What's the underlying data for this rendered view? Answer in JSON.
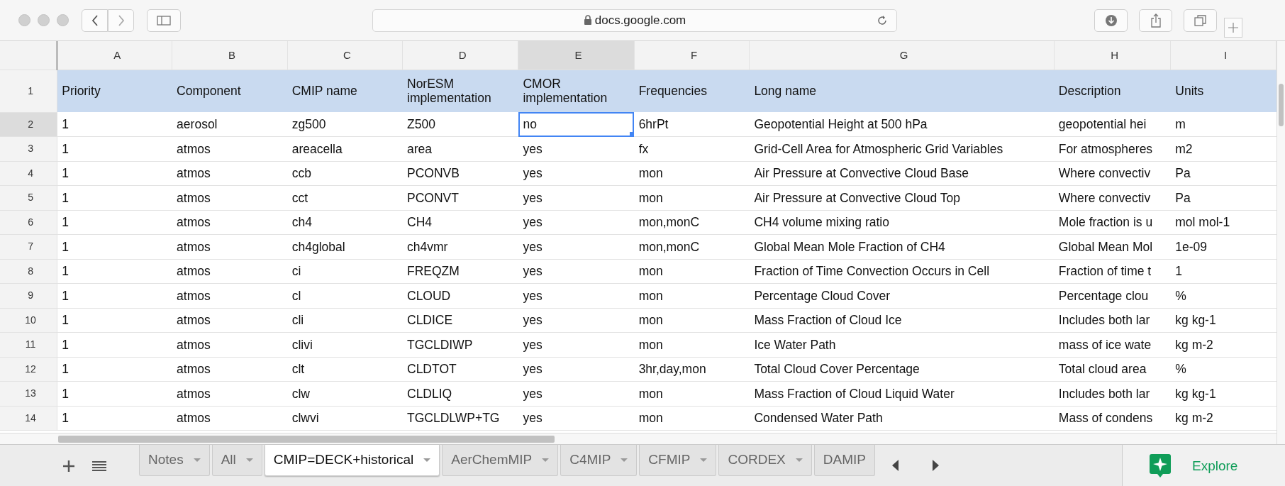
{
  "browser": {
    "address": "docs.google.com"
  },
  "columns": [
    {
      "label": "A",
      "selected": false
    },
    {
      "label": "B",
      "selected": false
    },
    {
      "label": "C",
      "selected": false
    },
    {
      "label": "D",
      "selected": false
    },
    {
      "label": "E",
      "selected": true
    },
    {
      "label": "F",
      "selected": false
    },
    {
      "label": "G",
      "selected": false
    },
    {
      "label": "H",
      "selected": false
    },
    {
      "label": "I",
      "selected": false
    }
  ],
  "header_row": {
    "number": "1",
    "cells": [
      "Priority",
      "Component",
      "CMIP name",
      "NorESM implementation",
      "CMOR implementation",
      "Frequencies",
      "Long name",
      "Description",
      "Units"
    ]
  },
  "rows": [
    {
      "number": "2",
      "selected": true,
      "cells": [
        "1",
        "aerosol",
        "zg500",
        "Z500",
        "no",
        "6hrPt",
        "Geopotential Height at 500 hPa",
        "geopotential hei",
        "m"
      ]
    },
    {
      "number": "3",
      "selected": false,
      "cells": [
        "1",
        "atmos",
        "areacella",
        "area",
        "yes",
        "fx",
        "Grid-Cell Area for Atmospheric Grid Variables",
        "For atmospheres",
        "m2"
      ]
    },
    {
      "number": "4",
      "selected": false,
      "cells": [
        "1",
        "atmos",
        "ccb",
        "PCONVB",
        "yes",
        "mon",
        "Air Pressure at Convective Cloud Base",
        "Where convectiv",
        "Pa"
      ]
    },
    {
      "number": "5",
      "selected": false,
      "cells": [
        "1",
        "atmos",
        "cct",
        "PCONVT",
        "yes",
        "mon",
        "Air Pressure at Convective Cloud Top",
        "Where convectiv",
        "Pa"
      ]
    },
    {
      "number": "6",
      "selected": false,
      "cells": [
        "1",
        "atmos",
        "ch4",
        "CH4",
        "yes",
        "mon,monC",
        "CH4 volume mixing ratio",
        "Mole fraction is u",
        "mol mol-1"
      ]
    },
    {
      "number": "7",
      "selected": false,
      "cells": [
        "1",
        "atmos",
        "ch4global",
        "ch4vmr",
        "yes",
        "mon,monC",
        "Global Mean Mole Fraction of CH4",
        "Global Mean Mol",
        "1e-09"
      ]
    },
    {
      "number": "8",
      "selected": false,
      "cells": [
        "1",
        "atmos",
        "ci",
        "FREQZM",
        "yes",
        "mon",
        "Fraction of Time Convection Occurs in Cell",
        "Fraction of time t",
        "1"
      ]
    },
    {
      "number": "9",
      "selected": false,
      "cells": [
        "1",
        "atmos",
        "cl",
        "CLOUD",
        "yes",
        "mon",
        "Percentage Cloud Cover",
        "Percentage clou",
        "%"
      ]
    },
    {
      "number": "10",
      "selected": false,
      "cells": [
        "1",
        "atmos",
        "cli",
        "CLDICE",
        "yes",
        "mon",
        "Mass Fraction of Cloud Ice",
        "Includes both lar",
        "kg kg-1"
      ]
    },
    {
      "number": "11",
      "selected": false,
      "cells": [
        "1",
        "atmos",
        "clivi",
        "TGCLDIWP",
        "yes",
        "mon",
        "Ice Water Path",
        "mass of ice wate",
        "kg m-2"
      ]
    },
    {
      "number": "12",
      "selected": false,
      "cells": [
        "1",
        "atmos",
        "clt",
        "CLDTOT",
        "yes",
        "3hr,day,mon",
        "Total Cloud Cover Percentage",
        "Total cloud area",
        "%"
      ]
    },
    {
      "number": "13",
      "selected": false,
      "cells": [
        "1",
        "atmos",
        "clw",
        "CLDLIQ",
        "yes",
        "mon",
        "Mass Fraction of Cloud Liquid Water",
        "Includes both lar",
        "kg kg-1"
      ]
    },
    {
      "number": "14",
      "selected": false,
      "cells": [
        "1",
        "atmos",
        "clwvi",
        "TGCLDLWP+TG",
        "yes",
        "mon",
        "Condensed Water Path",
        "Mass of condens",
        "kg m-2"
      ]
    }
  ],
  "sheet_tabs": [
    {
      "label": "Notes",
      "selected": false
    },
    {
      "label": "All",
      "selected": false
    },
    {
      "label": "CMIP=DECK+historical",
      "selected": true
    },
    {
      "label": "AerChemMIP",
      "selected": false
    },
    {
      "label": "C4MIP",
      "selected": false
    },
    {
      "label": "CFMIP",
      "selected": false
    },
    {
      "label": "CORDEX",
      "selected": false
    },
    {
      "label": "DAMIP",
      "selected": false
    }
  ],
  "explore_button": {
    "label": "Explore"
  }
}
